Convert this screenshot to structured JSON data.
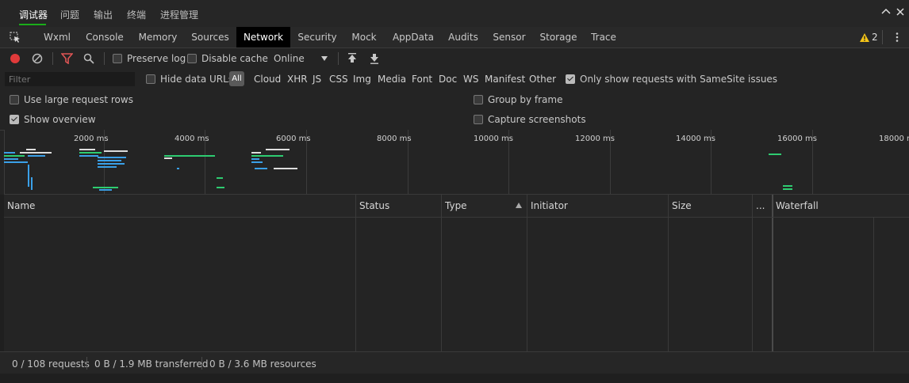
{
  "top_tabs": [
    "调试器",
    "问题",
    "输出",
    "终端",
    "进程管理"
  ],
  "dev_tabs": [
    "Wxml",
    "Console",
    "Memory",
    "Sources",
    "Network",
    "Security",
    "Mock",
    "AppData",
    "Audits",
    "Sensor",
    "Storage",
    "Trace"
  ],
  "warning_count": "2",
  "toolbar": {
    "preserve_log": "Preserve log",
    "disable_cache": "Disable cache",
    "throttling": "Online"
  },
  "filter": {
    "placeholder": "Filter",
    "hide_data_urls": "Hide data URLs",
    "all": "All",
    "types": [
      "Cloud",
      "XHR",
      "JS",
      "CSS",
      "Img",
      "Media",
      "Font",
      "Doc",
      "WS",
      "Manifest",
      "Other"
    ],
    "samesite": "Only show requests with SameSite issues"
  },
  "settings": {
    "large_rows": "Use large request rows",
    "show_overview": "Show overview",
    "group_by_frame": "Group by frame",
    "capture_screenshots": "Capture screenshots"
  },
  "overview_ticks": [
    "2000 ms",
    "4000 ms",
    "6000 ms",
    "8000 ms",
    "10000 ms",
    "12000 ms",
    "14000 ms",
    "16000 ms",
    "18000 ms"
  ],
  "columns": [
    "Name",
    "Status",
    "Type",
    "Initiator",
    "Size",
    "...",
    "Waterfall"
  ],
  "status": {
    "requests": "0 / 108 requests",
    "transferred": "0 B / 1.9 MB transferred",
    "resources": "0 B / 3.6 MB resources"
  },
  "colors": {
    "accent_green": "#1aad19",
    "record_red": "#e03a3a",
    "filter_red": "#e05555",
    "bar_blue": "#3aa0e8",
    "bar_green": "#2ecc71",
    "warning_yellow": "#f5c518"
  }
}
